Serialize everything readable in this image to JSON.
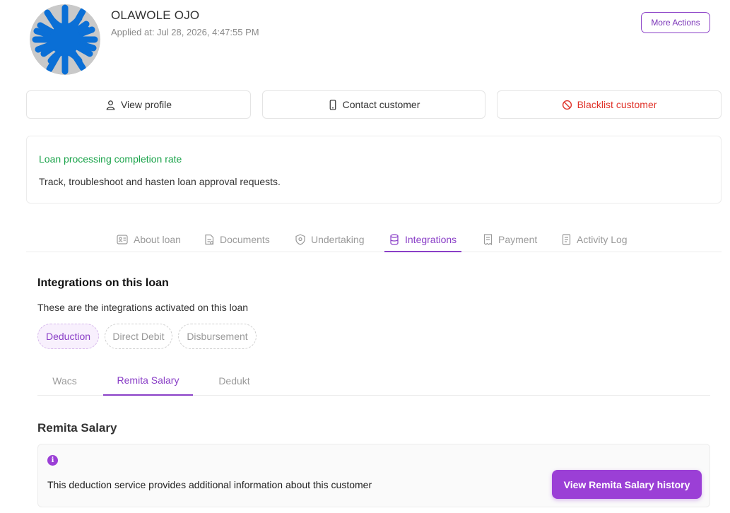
{
  "profile": {
    "name": "OLAWOLE OJO",
    "applied_at": "Applied at: Jul 28, 2026, 4:47:55 PM",
    "more_actions_label": "More Actions"
  },
  "actions": {
    "view_profile": "View profile",
    "contact_customer": "Contact customer",
    "blacklist_customer": "Blacklist customer"
  },
  "completion": {
    "title": "Loan processing completion rate",
    "description": "Track, troubleshoot and hasten loan approval requests."
  },
  "tabs": [
    {
      "label": "About loan",
      "icon": "id-card-icon"
    },
    {
      "label": "Documents",
      "icon": "document-icon"
    },
    {
      "label": "Undertaking",
      "icon": "shield-icon"
    },
    {
      "label": "Integrations",
      "icon": "database-icon"
    },
    {
      "label": "Payment",
      "icon": "receipt-icon"
    },
    {
      "label": "Activity Log",
      "icon": "log-icon"
    }
  ],
  "active_tab": "Integrations",
  "integrations": {
    "title": "Integrations on this loan",
    "description": "These are the integrations activated on this loan",
    "chips": [
      "Deduction",
      "Direct Debit",
      "Disbursement"
    ],
    "active_chip": "Deduction",
    "subtabs": [
      "Wacs",
      "Remita Salary",
      "Dedukt"
    ],
    "active_subtab": "Remita Salary"
  },
  "remita": {
    "title": "Remita Salary",
    "info_text": "This deduction service provides additional information about this customer",
    "history_button": "View Remita Salary history"
  },
  "colors": {
    "accent": "#8a3fc7",
    "button": "#9b3fd6",
    "success": "#1aa34a",
    "danger": "#e0342b",
    "avatar_scribble": "#0a6fd6"
  }
}
